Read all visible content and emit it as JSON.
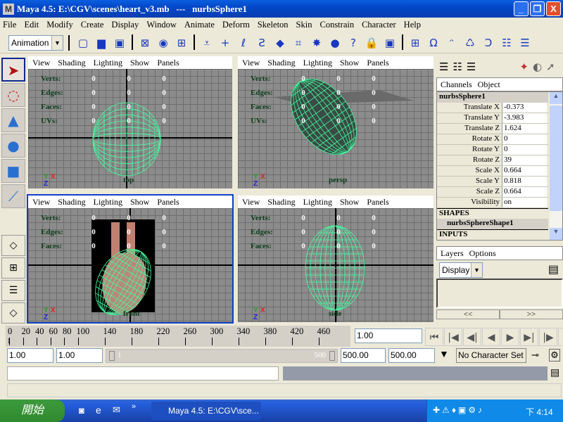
{
  "window": {
    "title": "Maya 4.5: E:\\CGV\\scenes\\heart_v3.mb   ---   nurbsSphere1",
    "minimize": "_",
    "restore": "❐",
    "close": "X"
  },
  "menu": [
    "File",
    "Edit",
    "Modify",
    "Create",
    "Display",
    "Window",
    "Animate",
    "Deform",
    "Skeleton",
    "Skin",
    "Constrain",
    "Character",
    "Help"
  ],
  "toolbar": {
    "menu_set": "Animation",
    "icons": [
      "new-scene-icon",
      "open-scene-icon",
      "save-scene-icon",
      "select-hierarchy-icon",
      "select-object-icon",
      "select-component-icon",
      "snap-icon",
      "snap-grid-icon",
      "snap-curve-icon",
      "snap-point-icon",
      "snap-plane-icon",
      "snap-surface-icon",
      "render-icon",
      "ipr-icon",
      "help-icon",
      "lock-icon",
      "select-highlight-icon",
      "outliner-icon",
      "hypergraph-icon",
      "curve-icon",
      "magnet-icon",
      "attribute-icon",
      "channel-box-icon",
      "tool-settings-icon"
    ]
  },
  "tools": [
    "select-tool",
    "lasso-tool",
    "move-tool",
    "rotate-tool",
    "scale-tool",
    "manipulator-tool"
  ],
  "viewports": [
    {
      "name": "top",
      "menu": [
        "View",
        "Shading",
        "Lighting",
        "Show",
        "Panels"
      ],
      "stats": [
        [
          "Verts:",
          "0",
          "0",
          "0"
        ],
        [
          "Edges:",
          "0",
          "0",
          "0"
        ],
        [
          "Faces:",
          "0",
          "0",
          "0"
        ],
        [
          "UVs:",
          "0",
          "0",
          "0"
        ]
      ],
      "axes": [
        "Y",
        "X",
        "Z"
      ]
    },
    {
      "name": "persp",
      "menu": [
        "View",
        "Shading",
        "Lighting",
        "Show",
        "Panels"
      ],
      "stats": [
        [
          "Verts:",
          "0",
          "0",
          "0"
        ],
        [
          "Edges:",
          "0",
          "0",
          "0"
        ],
        [
          "Faces:",
          "0",
          "0",
          "0"
        ],
        [
          "UVs:",
          "0",
          "0",
          "0"
        ]
      ],
      "axes": [
        "Y",
        "X",
        "Z"
      ]
    },
    {
      "name": "front",
      "menu": [
        "View",
        "Shading",
        "Lighting",
        "Show",
        "Panels"
      ],
      "stats": [
        [
          "Verts:",
          "0",
          "0",
          "0"
        ],
        [
          "Edges:",
          "0",
          "0",
          "0"
        ],
        [
          "Faces:",
          "0",
          "0",
          "0"
        ]
      ],
      "axes": [
        "Y",
        "X",
        "Z"
      ],
      "active": true
    },
    {
      "name": "side",
      "menu": [
        "View",
        "Shading",
        "Lighting",
        "Show",
        "Panels"
      ],
      "stats": [
        [
          "Verts:",
          "0",
          "0",
          "0"
        ],
        [
          "Edges:",
          "0",
          "0",
          "0"
        ],
        [
          "Faces:",
          "0",
          "0",
          "0"
        ]
      ],
      "axes": [
        "Y",
        "X",
        "Z"
      ]
    }
  ],
  "channel_box": {
    "tabs": [
      "Channels",
      "Object"
    ],
    "object": "nurbsSphere1",
    "attributes": [
      [
        "Translate X",
        "-0.373"
      ],
      [
        "Translate Y",
        "-3.983"
      ],
      [
        "Translate Z",
        "1.624"
      ],
      [
        "Rotate X",
        "0"
      ],
      [
        "Rotate Y",
        "0"
      ],
      [
        "Rotate Z",
        "39"
      ],
      [
        "Scale X",
        "0.664"
      ],
      [
        "Scale Y",
        "0.818"
      ],
      [
        "Scale Z",
        "0.664"
      ],
      [
        "Visibility",
        "on"
      ]
    ],
    "shapes_label": "SHAPES",
    "shape": "nurbsSphereShape1",
    "inputs_label": "INPUTS"
  },
  "layers": {
    "tabs": [
      "Layers",
      "Options"
    ],
    "mode": "Display",
    "prev": "<<",
    "next": ">>"
  },
  "timeline": {
    "ticks": [
      "0",
      "20",
      "40",
      "60",
      "80",
      "100",
      "140",
      "180",
      "220",
      "260",
      "300",
      "340",
      "380",
      "420",
      "460"
    ],
    "current_frame": "1.00",
    "current_marker": "1"
  },
  "range": {
    "start": "1.00",
    "playback_start": "1.00",
    "slider_start": "1",
    "slider_end": "500",
    "playback_end": "500.00",
    "end": "500.00",
    "character_set": "No Character Set"
  },
  "playback": [
    "⏮",
    "|◀",
    "◀|",
    "◀",
    "▶",
    "▶|",
    "|▶",
    "⏭"
  ],
  "taskbar": {
    "start": "開始",
    "task": "Maya 4.5: E:\\CGV\\sce...",
    "clock": "下 4:14",
    "more": "»"
  },
  "colors": {
    "title": "#0347c8",
    "wireframe": "#40ffa0",
    "viewport_bg": "#8c8c8c",
    "active_border": "#1040c8"
  }
}
